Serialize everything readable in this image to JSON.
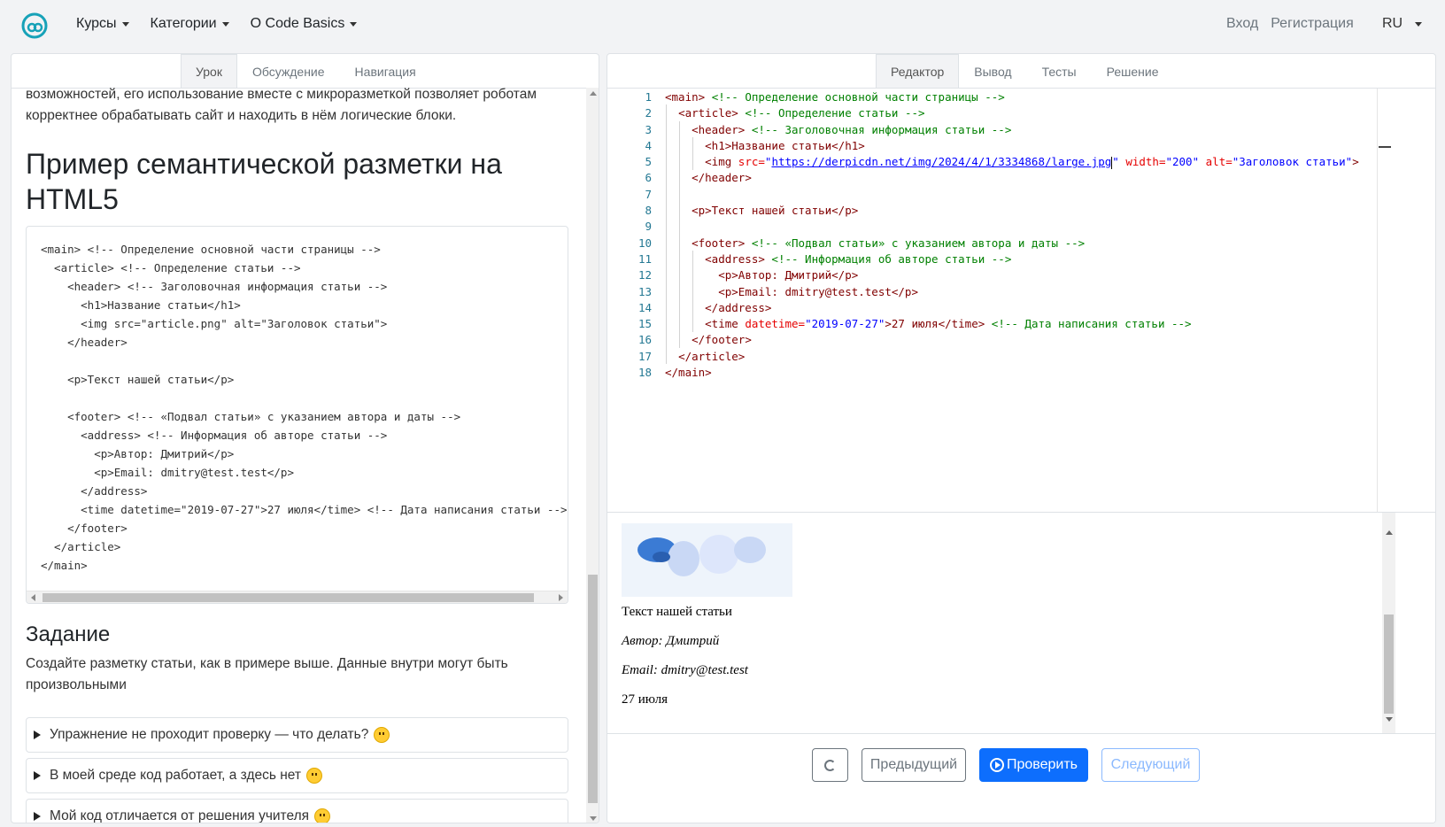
{
  "navbar": {
    "items": [
      {
        "label": "Курсы"
      },
      {
        "label": "Категории"
      },
      {
        "label": "О Code Basics"
      }
    ],
    "login": "Вход",
    "register": "Регистрация",
    "lang": "RU"
  },
  "left": {
    "tabs": [
      "Урок",
      "Обсуждение",
      "Навигация"
    ],
    "intro": "возможностей, его использование вместе с микроразметкой позволяет роботам корректнее обрабатывать сайт и находить в нём логические блоки.",
    "heading": "Пример семантической разметки на HTML5",
    "code": "<main> <!-- Определение основной части страницы -->\n  <article> <!-- Определение статьи -->\n    <header> <!-- Заголовочная информация статьи -->\n      <h1>Название статьи</h1>\n      <img src=\"article.png\" alt=\"Заголовок статьи\">\n    </header>\n\n    <p>Текст нашей статьи</p>\n\n    <footer> <!-- «Подвал статьи» с указанием автора и даты -->\n      <address> <!-- Информация об авторе статьи -->\n        <p>Автор: Дмитрий</p>\n        <p>Email: dmitry@test.test</p>\n      </address>\n      <time datetime=\"2019-07-27\">27 июля</time> <!-- Дата написания статьи -->\n    </footer>\n  </article>\n</main>",
    "task_heading": "Задание",
    "task_text": "Создайте разметку статьи, как в примере выше. Данные внутри могут быть произвольными",
    "faq": [
      "Упражнение не проходит проверку — что делать?",
      "В моей среде код работает, а здесь нет",
      "Мой код отличается от решения учителя"
    ]
  },
  "right": {
    "tabs": [
      "Редактор",
      "Вывод",
      "Тесты",
      "Решение"
    ],
    "line_numbers": [
      "1",
      "2",
      "3",
      "4",
      "5",
      "6",
      "7",
      "8",
      "9",
      "10",
      "11",
      "12",
      "13",
      "14",
      "15",
      "16",
      "17",
      "18"
    ],
    "editor": {
      "l1_tag": "<main>",
      "l1_cm": "<!-- Определение основной части страницы -->",
      "l2_tag": "<article>",
      "l2_cm": "<!-- Определение статьи -->",
      "l3_tag": "<header>",
      "l3_cm": "<!-- Заголовочная информация статьи -->",
      "l4": "<h1>Название статьи</h1>",
      "l5_tag": "<img",
      "l5_src_attr": "src=",
      "l5_src": "https://derpicdn.net/img/2024/4/1/3334868/large.jpg",
      "l5_w_attr": "width=",
      "l5_w": "\"200\"",
      "l5_alt_attr": "alt=",
      "l5_alt": "\"Заголовок статьи\"",
      "l5_close": ">",
      "l6": "</header>",
      "l8": "<p>Текст нашей статьи</p>",
      "l10_tag": "<footer>",
      "l10_cm": "<!-- «Подвал статьи» с указанием автора и даты -->",
      "l11_tag": "<address>",
      "l11_cm": "<!-- Информация об авторе статьи -->",
      "l12": "<p>Автор: Дмитрий</p>",
      "l13": "<p>Email: dmitry@test.test</p>",
      "l14": "</address>",
      "l15_tag": "<time",
      "l15_attr": "datetime=",
      "l15_val": "\"2019-07-27\"",
      "l15_rest": ">27 июля</time>",
      "l15_cm": "<!-- Дата написания статьи -->",
      "l16": "</footer>",
      "l17": "</article>",
      "l18": "</main>"
    },
    "output": {
      "text": "Текст нашей статьи",
      "author": "Автор: Дмитрий",
      "email": "Email: dmitry@test.test",
      "date": "27 июля"
    },
    "buttons": {
      "prev": "Предыдущий",
      "check": "Проверить",
      "next": "Следующий"
    }
  },
  "colors": {
    "primary": "#0d6efd",
    "tag": "#800000",
    "attr": "#e50000",
    "value": "#0000ff",
    "comment": "#008000"
  }
}
